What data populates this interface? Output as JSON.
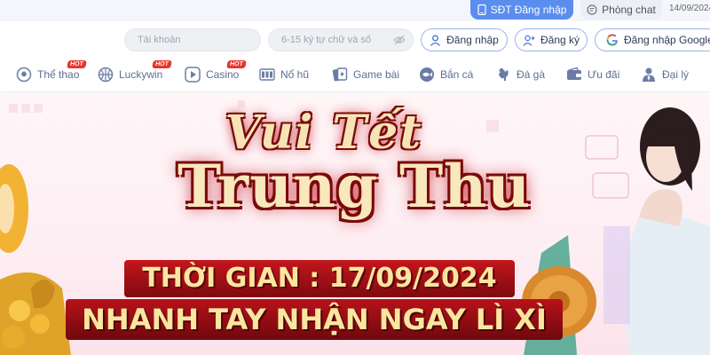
{
  "topbar": {
    "phone_login_label": "SĐT Đăng nhập",
    "chat_room_label": "Phòng chat",
    "date_text": "14/09/2024"
  },
  "login": {
    "username_placeholder": "Tài khoản",
    "password_placeholder": "6-15 ký tự chữ và số",
    "login_label": "Đăng nhập",
    "register_label": "Đăng ký",
    "google_label": "Đăng nhập Google"
  },
  "nav": {
    "items": [
      {
        "label": "Thể thao",
        "icon": "soccer-ball-icon",
        "hot": "HOT"
      },
      {
        "label": "Luckywin",
        "icon": "basketball-icon",
        "hot": "HOT"
      },
      {
        "label": "Casino",
        "icon": "play-icon",
        "hot": "HOT"
      },
      {
        "label": "Nổ hũ",
        "icon": "slot-machine-icon"
      },
      {
        "label": "Game bài",
        "icon": "cards-icon"
      },
      {
        "label": "Bắn cá",
        "icon": "fish-icon"
      },
      {
        "label": "Đá gà",
        "icon": "rooster-icon"
      },
      {
        "label": "Ưu đãi",
        "icon": "wallet-icon"
      },
      {
        "label": "Đại lý",
        "icon": "agent-icon"
      }
    ]
  },
  "banner": {
    "title_top": "Vui Tết",
    "title_main": "Trung Thu",
    "time_line": "THỜI GIAN : 17/09/2024",
    "promo_line": "NHANH TAY NHẬN NGAY LÌ XÌ"
  },
  "colors": {
    "accent_blue": "#5b8def",
    "nav_text": "#5d6e94",
    "hot_red": "#e7352b",
    "banner_red": "#c4161c",
    "banner_gold": "#fbe6a0"
  }
}
